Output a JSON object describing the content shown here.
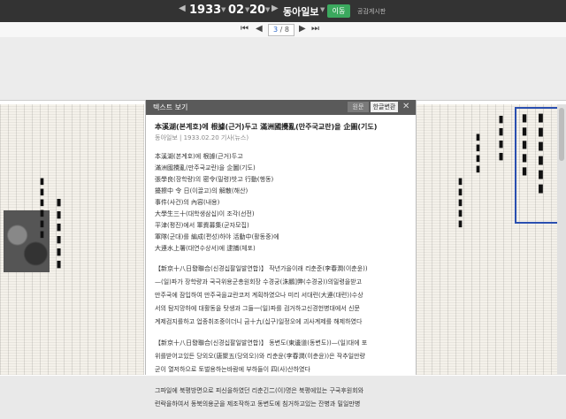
{
  "topbar": {
    "year": "1933",
    "month": "02",
    "day": "20",
    "newspaper": "동아일보",
    "move_label": "이동",
    "text_link": "공감게시판"
  },
  "pagebar": {
    "current_page": "3",
    "total_pages": "8"
  },
  "dialog": {
    "header_title": "텍스트 보기",
    "btn_original": "원문",
    "btn_hangul": "한글변환",
    "article_title": "本溪湖(본계호)에 根據(근거)두고 滿洲國攪亂(만주국교란)을 企圖(기도)",
    "article_meta": "동아일보 | 1933.02.20 기사(뉴스)",
    "short_lines": [
      "本溪湖(본계호)에 根據(근거)두고",
      "滿洲國攪亂(만주국교란)을 企圖(기도)",
      "張學良(장학량)의 密令(밀령)밧고 行動(행동)",
      "擾擦中 令 日(이끌고)의 解散(해산)",
      "事件(사건)의 內容(내용)",
      "大學生三十(대학생삼십)이 조각(선전)",
      "平津(평진)에서 軍資募集(군자모집)",
      "軍隊(군대)를 編成(편성)하야 活動中(활동중)에",
      "大連水上署(대연수상서)에 逮捕(체포)"
    ],
    "para1_lines": [
      "【新京十八日發聯合(신경십팔일발연합)】 작년가을이래 리춘준(李春潤(이춘윤))",
      "—(일)파가 장학량과 국극위용군총원회장 수경궁(洙鵬]弊(수경궁))의밀령을받고",
      "만주국에 잠입하여 만주국을교란코저 계획하였으나 미리 서대련(大連(대련))수상",
      "서의 탐지망하에 대활동을 탓생과 그들一(일)파를 검거하고신경헌병대에서 신문",
      "계제검지를하고 업종취조중이더니 금十九(십구)일정오에 괴사계제를 해제하였다"
    ],
    "para2_lines": [
      "【新京十八日發聯合(신경십팔일발연합)】 동변도(東邊道(동변도))—(일)대에 포",
      "위를받어고있든 당외오(唐聚五(당외오))와 리춘윤(李春潤(이춘윤))은 작추일만량",
      "군이 열저하으로 토벌용하는바람에 부하들이 四(사)산하였다"
    ],
    "para3_lines": [
      "그파일에 북평방면으로 피신을하였던 리춘긴二(이)명은 북평에있는 구국후원회와",
      "련락을하여서 동북의용군을 제조작하고 동변도에 침거하고있는 잔병과 밀일만병"
    ]
  }
}
